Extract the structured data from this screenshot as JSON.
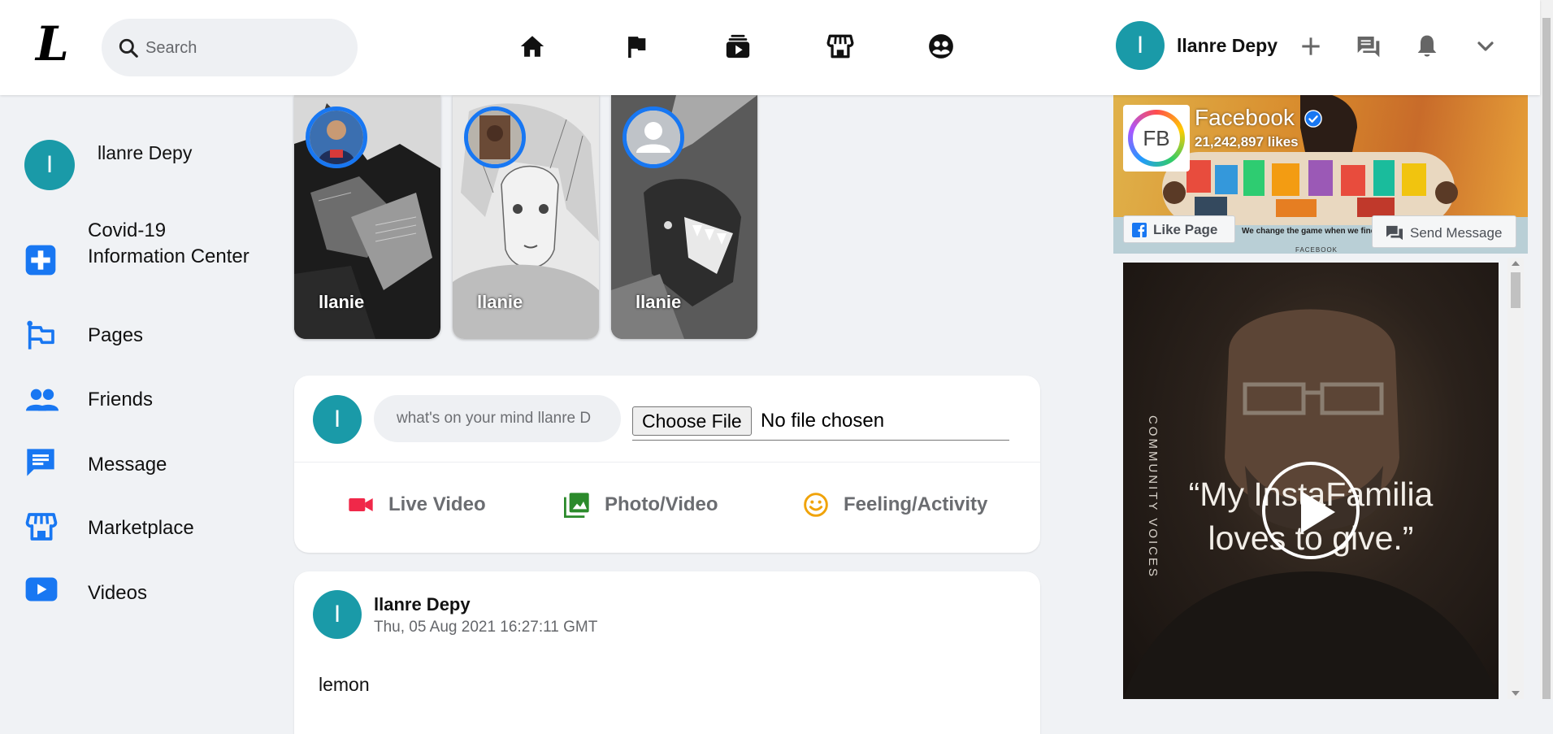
{
  "header": {
    "logo_text": "L",
    "search_placeholder": "Search",
    "nav_icons": [
      "home-icon",
      "flag-icon",
      "watch-icon",
      "marketplace-icon",
      "groups-icon"
    ],
    "user_initial": "I",
    "user_name": "llanre Depy",
    "right_icons": [
      "plus-icon",
      "messenger-icon",
      "bell-icon",
      "chevron-down-icon"
    ]
  },
  "sidebar": {
    "user_initial": "I",
    "user_name": "llanre Depy",
    "items": [
      {
        "label": "Covid-19 Information Center",
        "icon": "medical-cross-icon"
      },
      {
        "label": "Pages",
        "icon": "flag-icon"
      },
      {
        "label": "Friends",
        "icon": "people-icon"
      },
      {
        "label": "Message",
        "icon": "chat-icon"
      },
      {
        "label": "Marketplace",
        "icon": "store-icon"
      },
      {
        "label": "Videos",
        "icon": "video-icon"
      }
    ]
  },
  "stories": [
    {
      "name": "llanie"
    },
    {
      "name": "llanie"
    },
    {
      "name": "llanie"
    }
  ],
  "composer": {
    "user_initial": "I",
    "placeholder": "what's on your mind llanre D",
    "file_button": "Choose File",
    "file_status": "No file chosen",
    "actions": [
      {
        "label": "Live Video",
        "icon": "video-camera-icon",
        "color": "#f02849"
      },
      {
        "label": "Photo/Video",
        "icon": "photo-icon",
        "color": "#2b8a2b"
      },
      {
        "label": "Feeling/Activity",
        "icon": "smile-icon",
        "color": "#f0a30a"
      }
    ]
  },
  "post": {
    "user_initial": "I",
    "author": "llanre Depy",
    "timestamp": "Thu, 05 Aug 2021 16:27:11 GMT",
    "body": "lemon"
  },
  "page_card": {
    "logo_text": "FB",
    "title": "Facebook",
    "likes": "21,242,897 likes",
    "like_button": "Like Page",
    "message_button": "Send Message",
    "tagline": "We change the game when we find ea",
    "footer": "FACEBOOK"
  },
  "video_ad": {
    "quote_line1": "“My InstaFamilia",
    "quote_line2": "loves to give.”",
    "side_text": "COMMUNITY VOICES"
  },
  "colors": {
    "brand_blue": "#1877f2",
    "avatar_teal": "#1a9aa8",
    "page_bg": "#f0f2f5"
  }
}
